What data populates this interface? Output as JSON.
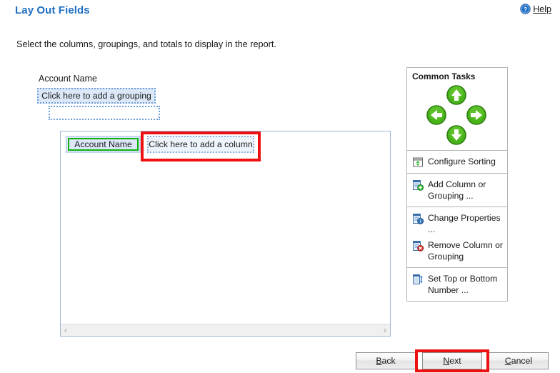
{
  "header": {
    "title": "Lay Out Fields",
    "help_label": "Help",
    "help_icon": "help-circle-icon"
  },
  "instruction": "Select the columns, groupings, and totals to display in the report.",
  "grouping": {
    "label": "Account Name",
    "add_grouping_text": "Click here to add a grouping",
    "empty_placeholder": ""
  },
  "design_surface": {
    "columns": [
      {
        "label": "Account Name",
        "state": "selected"
      },
      {
        "label": "Click here to add a column",
        "state": "placeholder"
      }
    ],
    "scrollbar": {
      "left_arrow": "‹",
      "right_arrow": "›"
    }
  },
  "common_tasks": {
    "title": "Common Tasks",
    "nav_buttons": [
      {
        "name": "move-up-button",
        "icon": "arrow-up-icon"
      },
      {
        "name": "move-left-button",
        "icon": "arrow-left-icon"
      },
      {
        "name": "move-right-button",
        "icon": "arrow-right-icon"
      },
      {
        "name": "move-down-button",
        "icon": "arrow-down-icon"
      }
    ],
    "groups": [
      {
        "items": [
          {
            "label": "Configure Sorting",
            "icon": "sort-window-icon"
          }
        ]
      },
      {
        "items": [
          {
            "label": "Add Column or Grouping ...",
            "icon": "add-column-icon"
          }
        ]
      },
      {
        "items": [
          {
            "label": "Change Properties ...",
            "icon": "properties-column-icon"
          },
          {
            "label": "Remove Column or Grouping",
            "icon": "remove-column-icon"
          }
        ]
      },
      {
        "items": [
          {
            "label": "Set Top or Bottom Number ...",
            "icon": "top-bottom-number-icon"
          }
        ]
      }
    ]
  },
  "footer": {
    "back": {
      "accel": "B",
      "rest": "ack"
    },
    "next": {
      "accel": "N",
      "rest": "ext"
    },
    "cancel": {
      "accel": "C",
      "rest": "ancel"
    }
  },
  "annotations": {
    "colors": {
      "highlight": "#ee1111",
      "selection": "#12b112",
      "title": "#1f6fc4"
    }
  }
}
